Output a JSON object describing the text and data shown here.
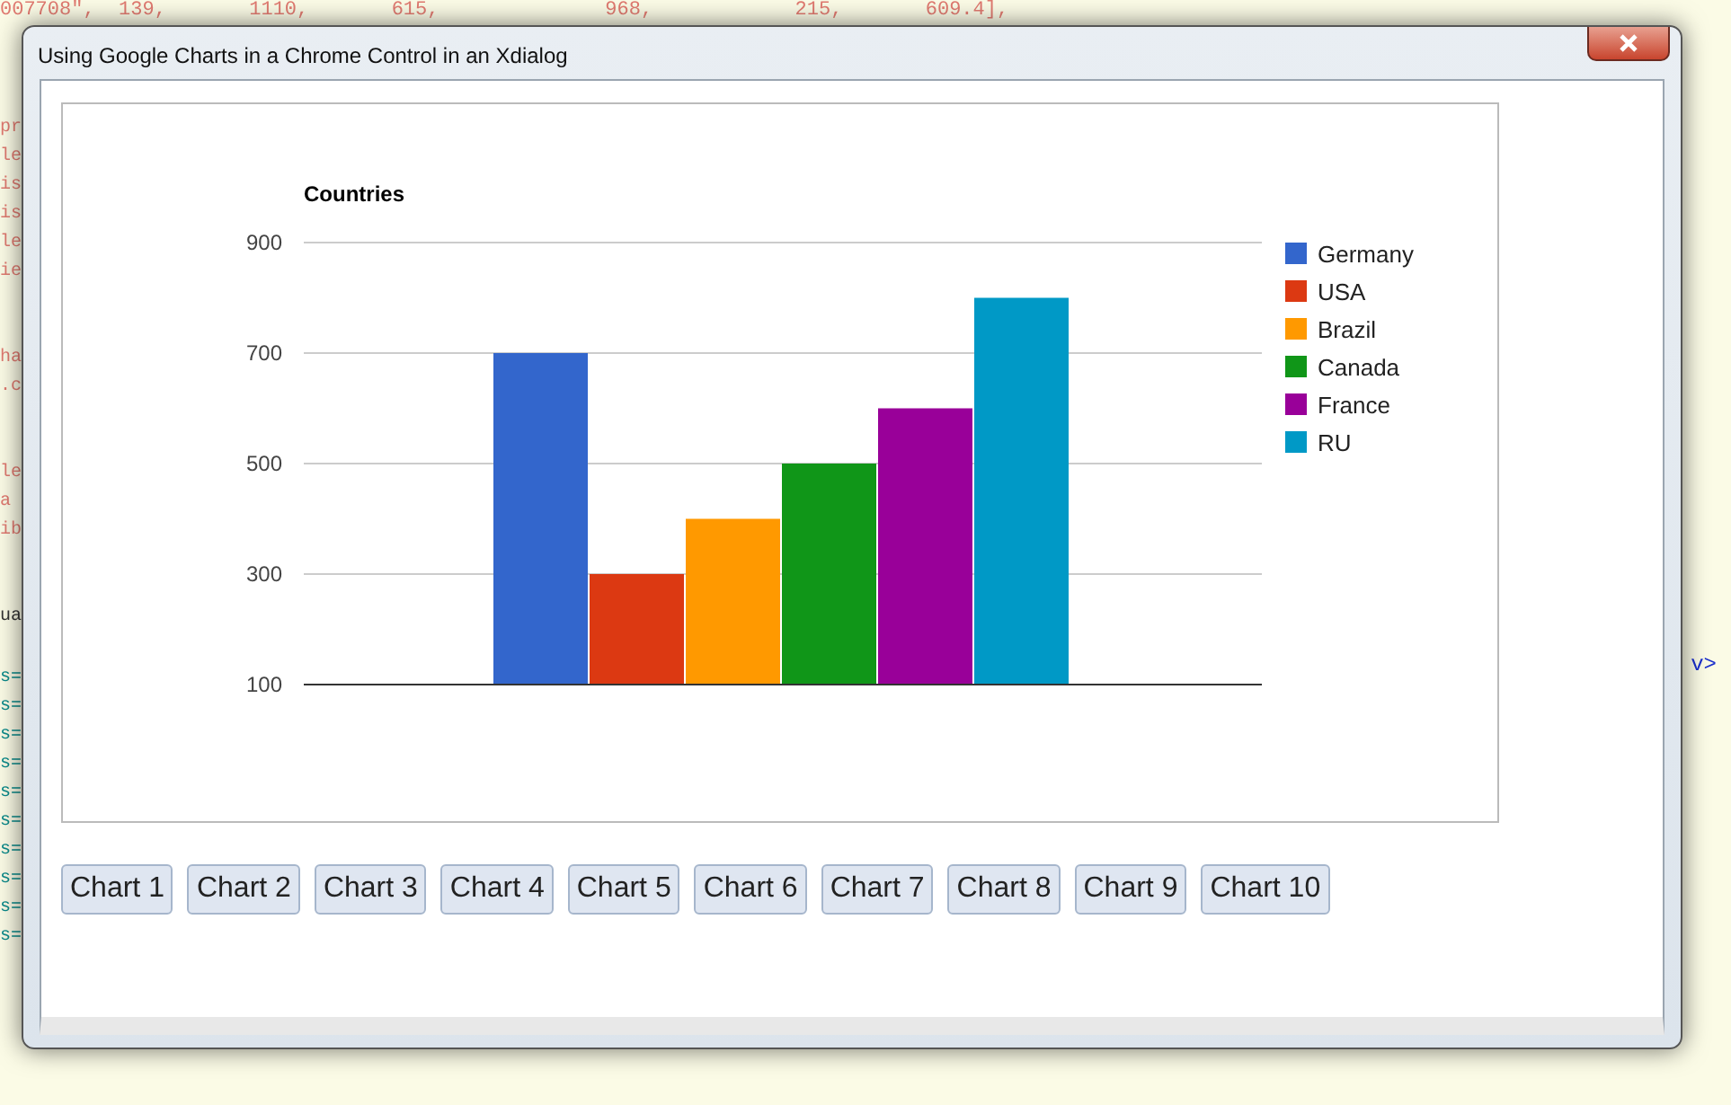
{
  "editor_background": {
    "top_line": "007708\",  139,       1110,       615,              968,            215,       609.4],",
    "left_groups": [
      [
        "pr",
        "le",
        "is",
        "is",
        "le",
        "ie"
      ],
      [
        "ha",
        ".c"
      ],
      [
        "le",
        "a",
        "ib"
      ],
      [
        "ua"
      ],
      [
        "s=",
        "s=",
        "s=",
        "s=",
        "s=",
        "s=",
        "s=",
        "s=",
        "s=",
        "s="
      ]
    ],
    "right_fragment": "v>"
  },
  "window": {
    "title": "Using Google Charts in a Chrome Control in an Xdialog"
  },
  "chart": {
    "chart_data": {
      "type": "bar",
      "title": "Countries",
      "grid": true,
      "legend": "right",
      "ylim": [
        100,
        900
      ],
      "yticks": [
        100,
        300,
        500,
        700,
        900
      ],
      "series": [
        {
          "name": "Germany",
          "color": "#3366cc",
          "values": [
            700
          ]
        },
        {
          "name": "USA",
          "color": "#dc3912",
          "values": [
            300
          ]
        },
        {
          "name": "Brazil",
          "color": "#ff9900",
          "values": [
            400
          ]
        },
        {
          "name": "Canada",
          "color": "#109618",
          "values": [
            500
          ]
        },
        {
          "name": "France",
          "color": "#990099",
          "values": [
            600
          ]
        },
        {
          "name": "RU",
          "color": "#0099c6",
          "values": [
            800
          ]
        }
      ]
    }
  },
  "buttons": [
    "Chart 1",
    "Chart 2",
    "Chart 3",
    "Chart 4",
    "Chart 5",
    "Chart 6",
    "Chart 7",
    "Chart 8",
    "Chart 9",
    "Chart 10"
  ]
}
